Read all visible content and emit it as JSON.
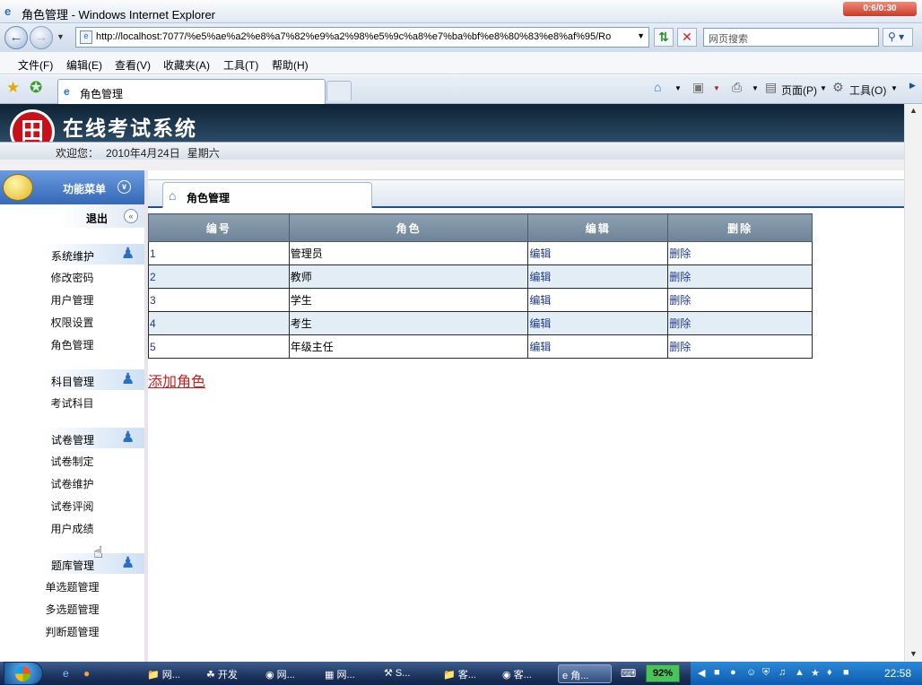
{
  "window": {
    "title": "角色管理 - Windows Internet Explorer",
    "clock_badge": "0:6/0:30"
  },
  "address": {
    "url": "http://localhost:7077/%e5%ae%a2%e8%a7%82%e9%a2%98%e5%9c%a8%e7%ba%bf%e8%80%83%e8%af%95/Ro",
    "search_placeholder": "网页搜索"
  },
  "menu": {
    "file": "文件(F)",
    "edit": "编辑(E)",
    "view": "查看(V)",
    "favorites": "收藏夹(A)",
    "tools": "工具(T)",
    "help": "帮助(H)"
  },
  "favtab": {
    "label": "角色管理"
  },
  "commands": {
    "page": "页面(P)",
    "tools": "工具(O)"
  },
  "site": {
    "logo_text": "田",
    "title": "在线考试系统",
    "welcome_label": "欢迎您：",
    "date": "2010年4月24日",
    "weekday": "星期六"
  },
  "sidebar": {
    "header": "功能菜单",
    "logout": "退出",
    "groups": [
      {
        "label": "系统维护",
        "items": [
          "修改密码",
          "用户管理",
          "权限设置",
          "角色管理"
        ]
      },
      {
        "label": "科目管理",
        "items": [
          "考试科目"
        ]
      },
      {
        "label": "试卷管理",
        "items": [
          "试卷制定",
          "试卷维护",
          "试卷评阅",
          "用户成绩"
        ]
      },
      {
        "label": "题库管理",
        "items": [
          "单选题管理",
          "多选题管理",
          "判断题管理"
        ]
      }
    ]
  },
  "main": {
    "tab": "角色管理",
    "columns": [
      "编号",
      "角色",
      "编辑",
      "删除"
    ],
    "rows": [
      {
        "id": "1",
        "role": "管理员",
        "edit": "编辑",
        "del": "删除"
      },
      {
        "id": "2",
        "role": "教师",
        "edit": "编辑",
        "del": "删除"
      },
      {
        "id": "3",
        "role": "学生",
        "edit": "编辑",
        "del": "删除"
      },
      {
        "id": "4",
        "role": "考生",
        "edit": "编辑",
        "del": "删除"
      },
      {
        "id": "5",
        "role": "年级主任",
        "edit": "编辑",
        "del": "删除"
      }
    ],
    "add_link": "添加角色"
  },
  "taskbar": {
    "buttons": [
      {
        "label": "网..."
      },
      {
        "label": "开发"
      },
      {
        "label": "网..."
      },
      {
        "label": "网..."
      },
      {
        "label": "S..."
      },
      {
        "label": "客..."
      },
      {
        "label": "客..."
      },
      {
        "label": "角..."
      }
    ],
    "percent": "92%",
    "time": "22:58"
  }
}
